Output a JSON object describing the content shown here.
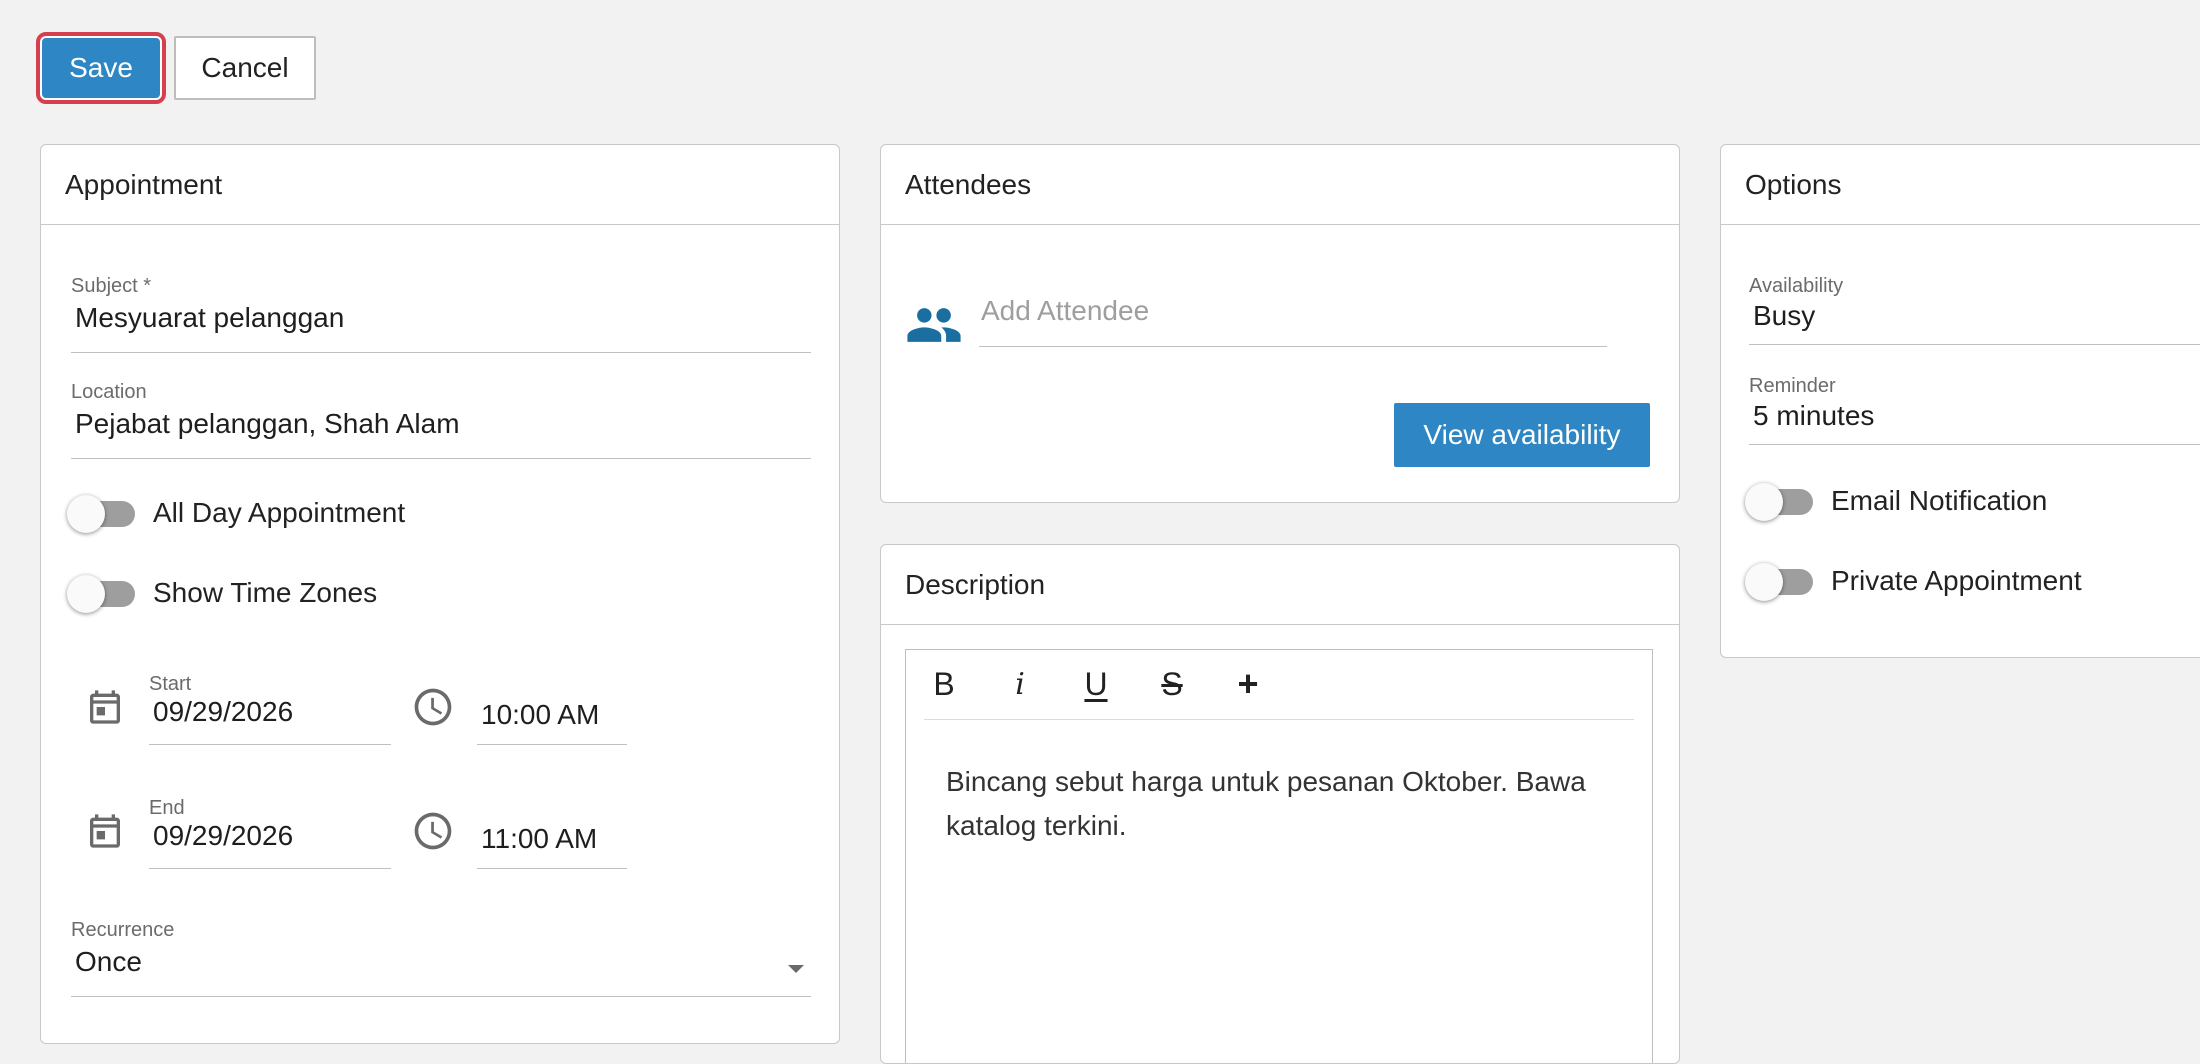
{
  "toolbar": {
    "save_label": "Save",
    "cancel_label": "Cancel"
  },
  "appointment": {
    "title": "Appointment",
    "subject": {
      "label": "Subject *",
      "value": "Mesyuarat pelanggan"
    },
    "location": {
      "label": "Location",
      "value": "Pejabat pelanggan, Shah Alam"
    },
    "all_day_label": "All Day Appointment",
    "all_day_on": false,
    "time_zones_label": "Show Time Zones",
    "time_zones_on": false,
    "start": {
      "label": "Start",
      "date": "09/29/2026",
      "time": "10:00 AM"
    },
    "end": {
      "label": "End",
      "date": "09/29/2026",
      "time": "11:00 AM"
    },
    "recurrence": {
      "label": "Recurrence",
      "value": "Once"
    }
  },
  "attendees": {
    "title": "Attendees",
    "placeholder": "Add Attendee",
    "view_availability_label": "View availability"
  },
  "description": {
    "title": "Description",
    "toolbar": {
      "bold": "B",
      "italic": "i",
      "underline": "U",
      "strike": "S",
      "more": "+"
    },
    "text": "Bincang sebut harga untuk pesanan Oktober. Bawa katalog terkini."
  },
  "options": {
    "title": "Options",
    "availability": {
      "label": "Availability",
      "value": "Busy"
    },
    "reminder": {
      "label": "Reminder",
      "value": "5 minutes"
    },
    "email_notification_label": "Email Notification",
    "email_notification_on": false,
    "private_label": "Private Appointment",
    "private_on": false
  },
  "colors": {
    "accent": "#2e87c4",
    "focus_ring": "#d6404e",
    "attendee_icon": "#1a6fa0"
  }
}
